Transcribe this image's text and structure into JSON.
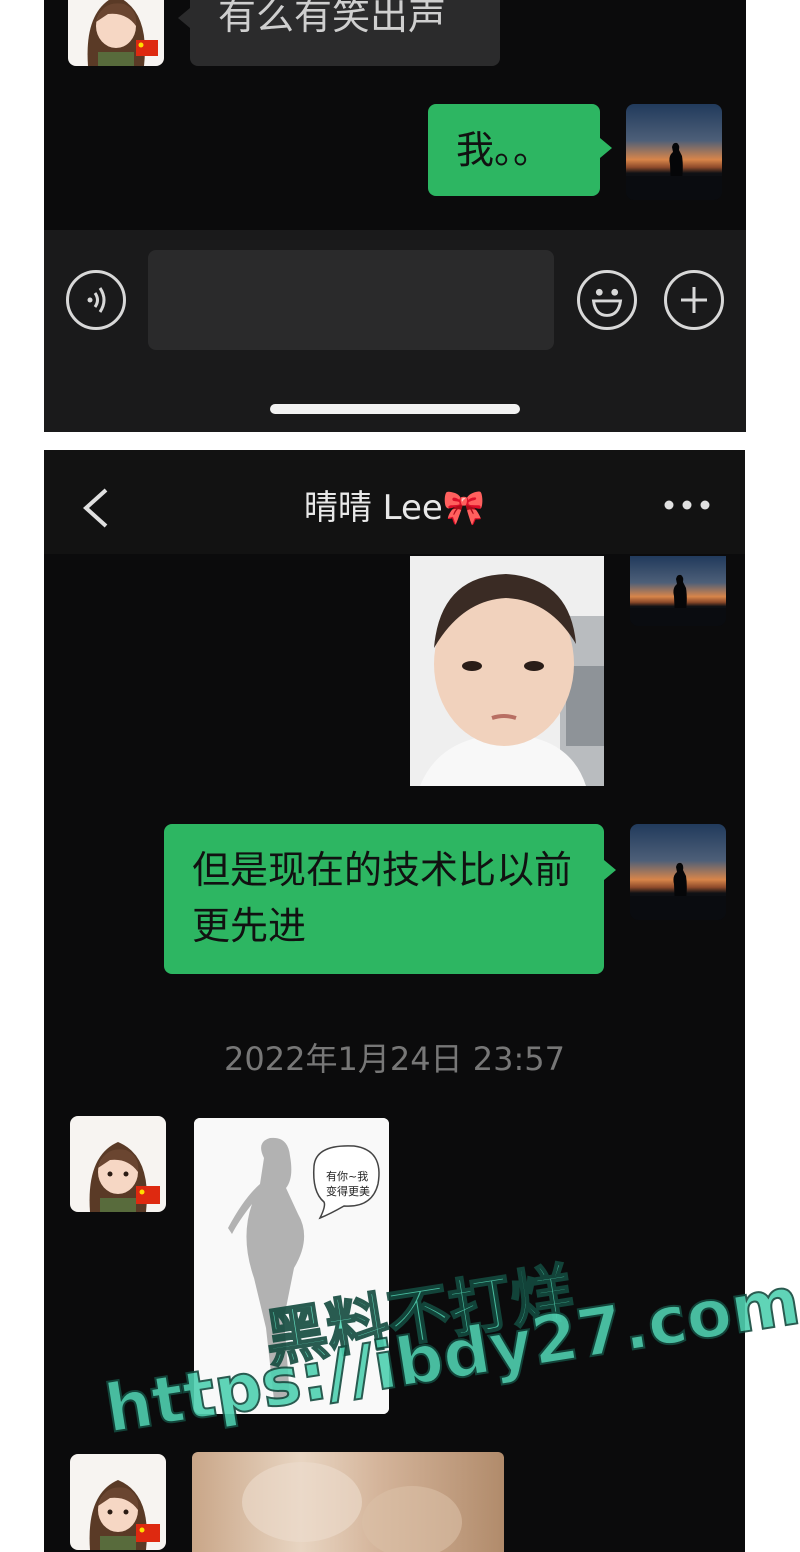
{
  "top_chat": {
    "partial_message": "有么有笑出声",
    "my_message": "我。。"
  },
  "chat": {
    "contact_name": "晴晴 Lee🎀",
    "messages": [
      {
        "from": "me",
        "type": "image"
      },
      {
        "from": "me",
        "type": "text",
        "text": "但是现在的技术比以前更先进"
      },
      {
        "from": "them",
        "type": "image",
        "sticker_text": "有你~我\n变得更美"
      },
      {
        "from": "them",
        "type": "image"
      }
    ],
    "timestamp": "2022年1月24日 23:57"
  },
  "icons": {
    "voice": "voice-input-icon",
    "emoji": "emoji-icon",
    "plus": "plus-icon",
    "back": "back-chevron-icon",
    "more": "more-dots-icon"
  },
  "watermark": {
    "line1": "黑料不打烊",
    "line2": "https://ibdy27.com"
  },
  "colors": {
    "bubble_green": "#2db662",
    "bubble_gray": "#2b2b2c",
    "background": "#0b0b0c"
  }
}
